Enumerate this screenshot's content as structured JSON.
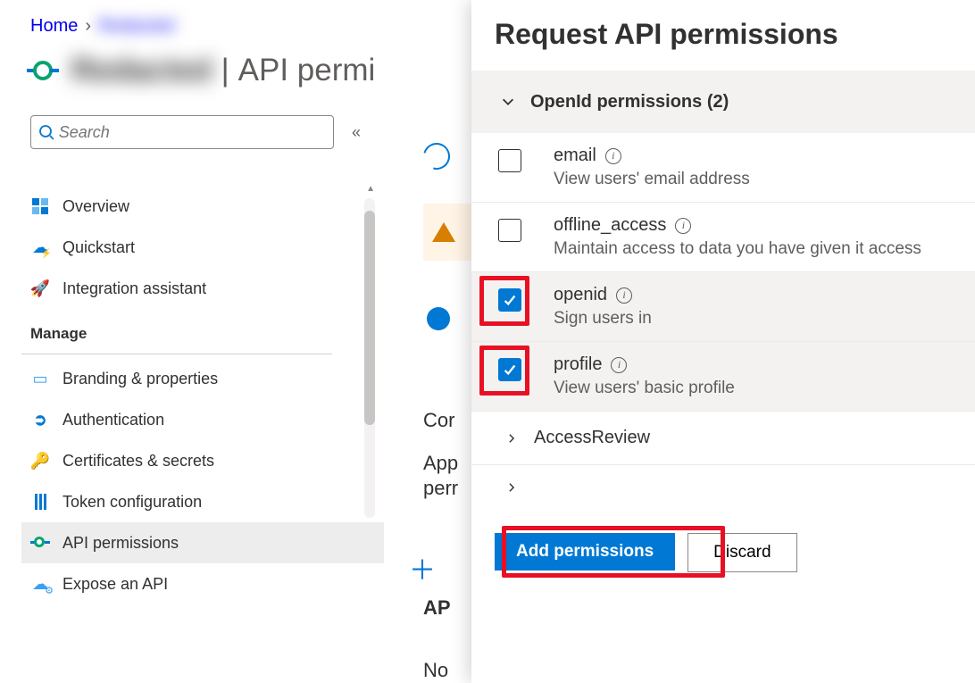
{
  "breadcrumb": {
    "home": "Home",
    "app": "Redacted"
  },
  "title": {
    "app": "Redacted",
    "section": "API permi"
  },
  "search": {
    "placeholder": "Search"
  },
  "nav": {
    "overview": "Overview",
    "quickstart": "Quickstart",
    "integration": "Integration assistant",
    "manage_header": "Manage",
    "branding": "Branding & properties",
    "authentication": "Authentication",
    "certificates": "Certificates & secrets",
    "token": "Token configuration",
    "api_permissions": "API permissions",
    "expose": "Expose an API"
  },
  "main": {
    "heading_partial": "Cor",
    "line1": "App",
    "line2": "perr",
    "line3": "AP",
    "line4": "No"
  },
  "panel": {
    "title": "Request API permissions",
    "group_label": "OpenId permissions (2)",
    "perms": [
      {
        "name": "email",
        "desc": "View users' email address",
        "checked": false
      },
      {
        "name": "offline_access",
        "desc": "Maintain access to data you have given it access",
        "checked": false
      },
      {
        "name": "openid",
        "desc": "Sign users in",
        "checked": true
      },
      {
        "name": "profile",
        "desc": "View users' basic profile",
        "checked": true
      }
    ],
    "expander1": "AccessReview",
    "add_button": "Add permissions",
    "discard_button": "Discard"
  }
}
